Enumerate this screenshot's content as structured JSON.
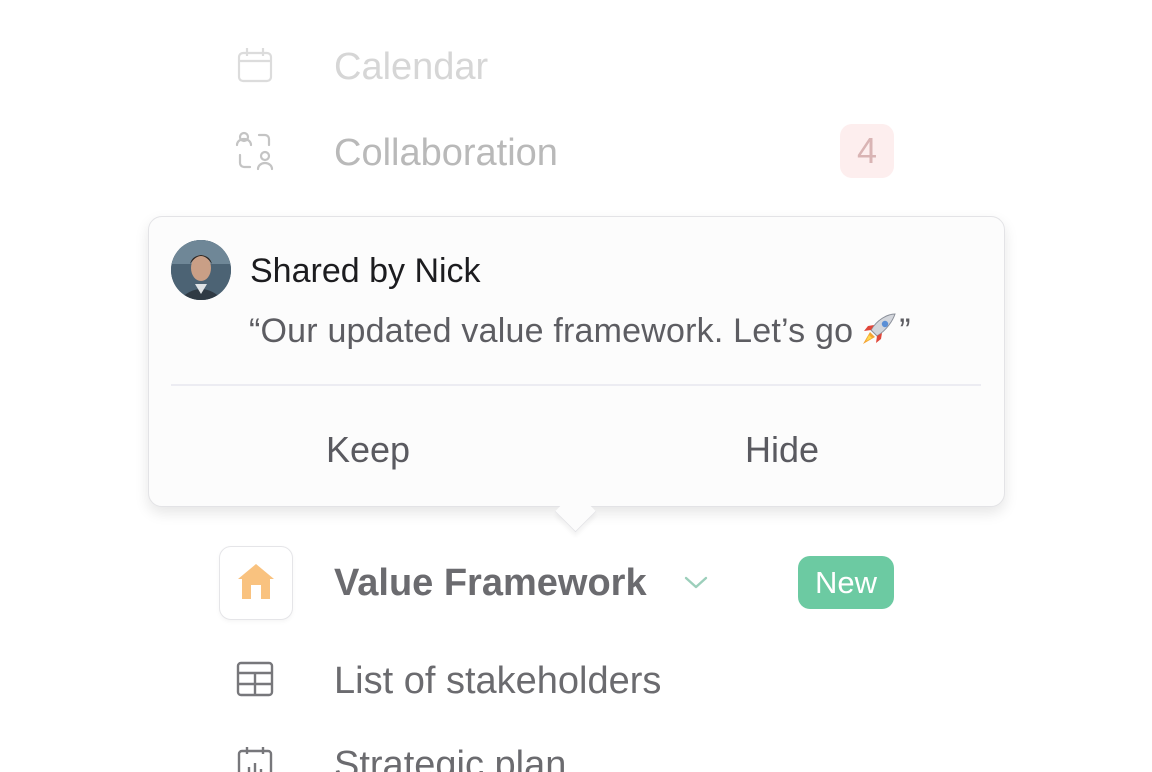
{
  "nav": {
    "calendar": {
      "label": "Calendar",
      "icon": "calendar-icon"
    },
    "collaboration": {
      "label": "Collaboration",
      "icon": "collaboration-icon",
      "badge": "4"
    },
    "value_framework": {
      "label": "Value Framework",
      "icon": "home-icon",
      "badge": "New"
    },
    "stakeholders": {
      "label": "List of stakeholders",
      "icon": "table-icon"
    },
    "strategic_plan": {
      "label": "Strategic plan",
      "icon": "chart-icon"
    }
  },
  "popover": {
    "title": "Shared by Nick",
    "quote": "“Our updated value framework. Let’s go",
    "quote_end": "”",
    "keep_label": "Keep",
    "hide_label": "Hide"
  },
  "colors": {
    "new_badge": "#6ccaa2",
    "count_badge_bg": "#fdeeee",
    "home_icon": "#f9c27f"
  }
}
